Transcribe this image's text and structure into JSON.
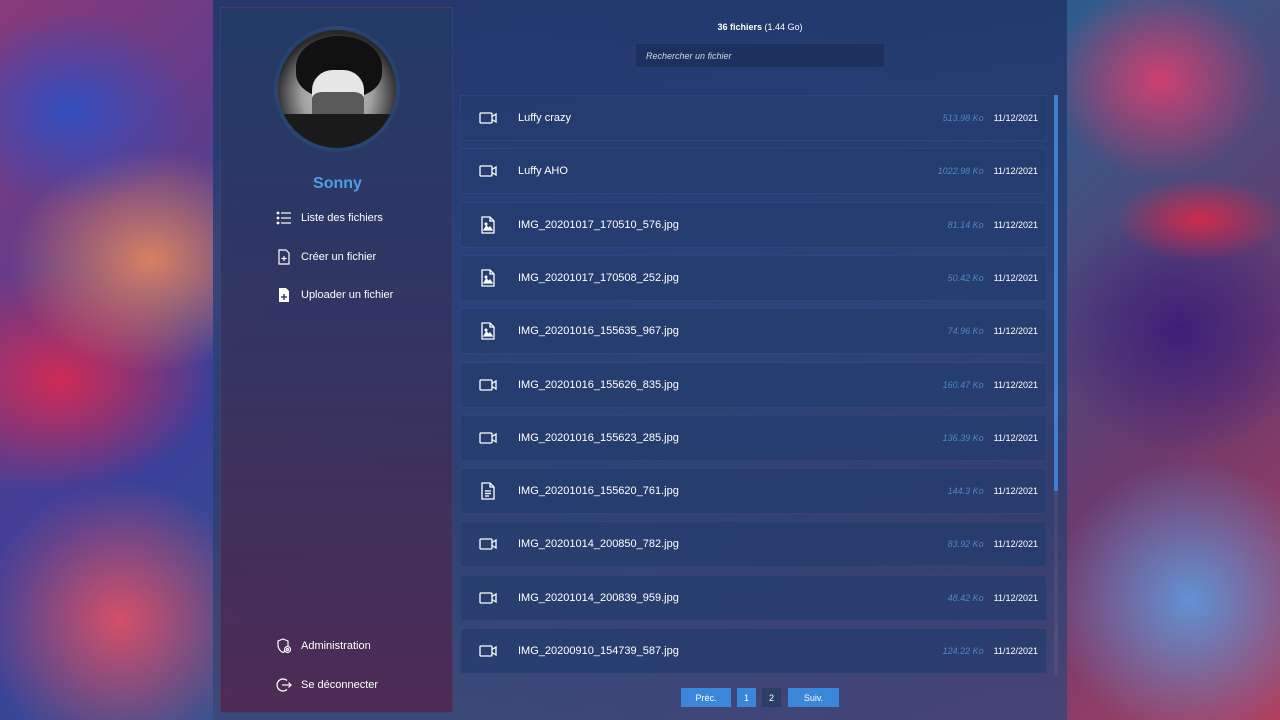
{
  "user": {
    "name": "Sonny"
  },
  "nav": [
    {
      "label": "Liste des fichiers",
      "icon": "list-icon"
    },
    {
      "label": "Créer un fichier",
      "icon": "file-plus-icon"
    },
    {
      "label": "Uploader un fichier",
      "icon": "file-upload-icon"
    }
  ],
  "nav_bottom": [
    {
      "label": "Administration",
      "icon": "admin-shield-icon"
    },
    {
      "label": "Se déconnecter",
      "icon": "logout-icon"
    }
  ],
  "summary": {
    "count": "36 fichiers",
    "size": "(1.44 Go)"
  },
  "search": {
    "placeholder": "Rechercher un fichier"
  },
  "files": [
    {
      "name": "Luffy crazy",
      "size": "513.98 Ko",
      "date": "11/12/2021",
      "icon": "video-icon"
    },
    {
      "name": "Luffy AHO",
      "size": "1022.98 Ko",
      "date": "11/12/2021",
      "icon": "video-icon"
    },
    {
      "name": "IMG_20201017_170510_576.jpg",
      "size": "81.14 Ko",
      "date": "11/12/2021",
      "icon": "image-file-icon"
    },
    {
      "name": "IMG_20201017_170508_252.jpg",
      "size": "50.42 Ko",
      "date": "11/12/2021",
      "icon": "image-file-icon"
    },
    {
      "name": "IMG_20201016_155635_967.jpg",
      "size": "74.96 Ko",
      "date": "11/12/2021",
      "icon": "image-file-icon"
    },
    {
      "name": "IMG_20201016_155626_835.jpg",
      "size": "160.47 Ko",
      "date": "11/12/2021",
      "icon": "video-icon"
    },
    {
      "name": "IMG_20201016_155623_285.jpg",
      "size": "136.39 Ko",
      "date": "11/12/2021",
      "icon": "video-icon"
    },
    {
      "name": "IMG_20201016_155620_761.jpg",
      "size": "144.3 Ko",
      "date": "11/12/2021",
      "icon": "text-file-icon"
    },
    {
      "name": "IMG_20201014_200850_782.jpg",
      "size": "83.92 Ko",
      "date": "11/12/2021",
      "icon": "video-icon"
    },
    {
      "name": "IMG_20201014_200839_959.jpg",
      "size": "48.42 Ko",
      "date": "11/12/2021",
      "icon": "video-icon"
    },
    {
      "name": "IMG_20200910_154739_587.jpg",
      "size": "124.22 Ko",
      "date": "11/12/2021",
      "icon": "video-icon"
    }
  ],
  "pagination": {
    "prev": "Préc.",
    "next": "Suiv.",
    "pages": [
      "1",
      "2"
    ],
    "current": "2"
  }
}
